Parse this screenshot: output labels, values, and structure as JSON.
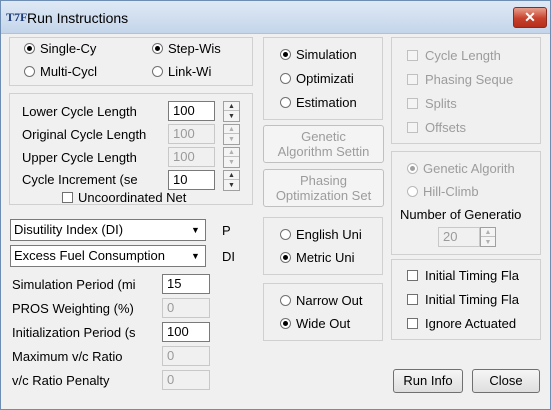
{
  "window": {
    "title": "Run Instructions",
    "icon_text": "T7F",
    "close_glyph": "✕"
  },
  "cycle_type": {
    "options": [
      "Single-Cy",
      "Multi-Cycl"
    ],
    "selected": "Single-Cy"
  },
  "search_method": {
    "options": [
      "Step-Wis",
      "Link-Wi"
    ],
    "selected": "Step-Wis"
  },
  "run_mode": {
    "options": [
      "Simulation",
      "Optimizati",
      "Estimation"
    ],
    "selected": "Simulation"
  },
  "optimize_items": [
    "Cycle Length",
    "Phasing Seque",
    "Splits",
    "Offsets"
  ],
  "cycle_fields": [
    {
      "label": "Lower Cycle Length",
      "value": "100",
      "enabled": true
    },
    {
      "label": "Original Cycle Length",
      "value": "100",
      "enabled": false
    },
    {
      "label": "Upper Cycle Length",
      "value": "100",
      "enabled": false
    },
    {
      "label": "Cycle Increment (se",
      "value": "10",
      "enabled": true
    }
  ],
  "uncoordinated_net": "Uncoordinated Net",
  "buttons": {
    "genetic_settings": [
      "Genetic",
      "Algorithm Settin"
    ],
    "phasing_optimization": [
      "Phasing",
      "Optimization Set"
    ],
    "run_info": "Run Info",
    "close": "Close"
  },
  "algorithm": {
    "options": [
      "Genetic Algorith",
      "Hill-Climb"
    ],
    "selected": "Genetic Algorith",
    "generations_label": "Number of Generatio",
    "generations_value": "20"
  },
  "dropdowns": [
    {
      "value": "Disutility Index (DI)",
      "suffix": "P"
    },
    {
      "value": "Excess Fuel Consumption",
      "suffix": "DI"
    }
  ],
  "units": {
    "options": [
      "English Uni",
      "Metric Uni"
    ],
    "selected": "Metric Uni"
  },
  "offsets": {
    "options": [
      "Narrow Out",
      "Wide Out"
    ],
    "selected": "Wide Out"
  },
  "timing_checks": [
    "Initial Timing Fla",
    "Initial Timing Fla",
    "Ignore Actuated"
  ],
  "sim_fields": [
    {
      "label": "Simulation Period (mi",
      "value": "15",
      "enabled": true
    },
    {
      "label": "PROS Weighting (%)",
      "value": "0",
      "enabled": false
    },
    {
      "label": "Initialization Period (s",
      "value": "100",
      "enabled": true
    },
    {
      "label": "Maximum v/c Ratio",
      "value": "0",
      "enabled": false
    },
    {
      "label": "v/c Ratio Penalty",
      "value": "0",
      "enabled": false
    }
  ]
}
